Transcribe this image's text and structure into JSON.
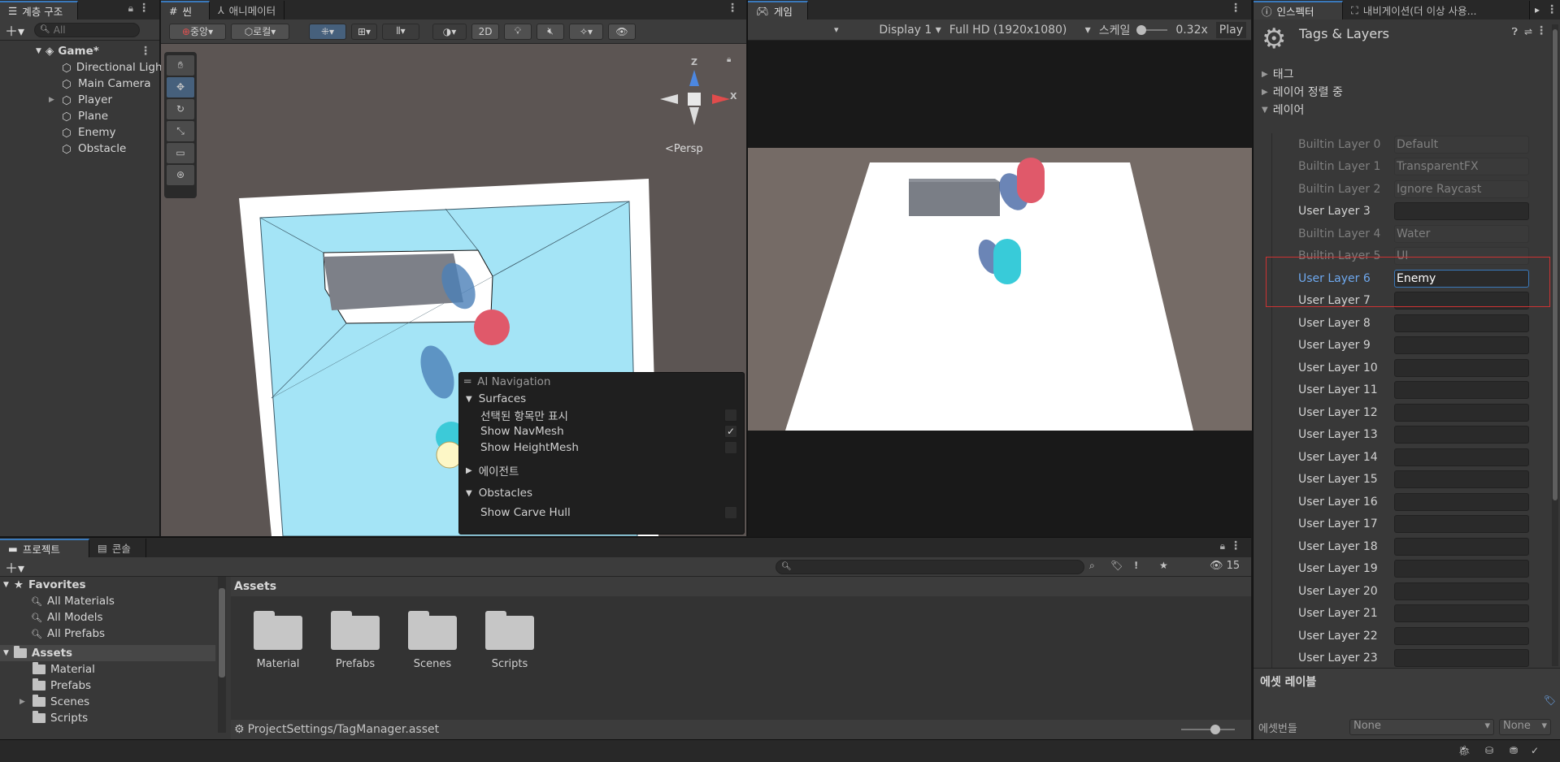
{
  "hierarchy": {
    "tab_label": "계층 구조",
    "search_placeholder": "All",
    "scene_name": "Game*",
    "items": [
      {
        "label": "Directional Light"
      },
      {
        "label": "Main Camera"
      },
      {
        "label": "Player"
      },
      {
        "label": "Plane"
      },
      {
        "label": "Enemy"
      },
      {
        "label": "Obstacle"
      }
    ]
  },
  "scene": {
    "tab_label": "씬",
    "anim_tab_label": "애니메이터",
    "pivot_label": "중앙",
    "space_label": "로컬",
    "mode_2d": "2D",
    "persp_label": "Persp",
    "gizmo_axes": {
      "y": "Z",
      "x": "X"
    }
  },
  "ai_navigation": {
    "title": "AI Navigation",
    "surfaces_label": "Surfaces",
    "options": [
      {
        "label": "선택된 항목만 표시",
        "checked": false
      },
      {
        "label": "Show NavMesh",
        "checked": true
      },
      {
        "label": "Show HeightMesh",
        "checked": false
      }
    ],
    "agents_label": "에이전트",
    "obstacles_label": "Obstacles",
    "carve_hull_label": "Show Carve Hull",
    "carve_hull_checked": false
  },
  "game": {
    "tab_label": "게임",
    "display": "Display 1",
    "resolution": "Full HD (1920x1080)",
    "scale_label": "스케일",
    "scale_value": "0.32x",
    "play_label": "Play"
  },
  "inspector": {
    "tab_label": "인스펙터",
    "nav_tab_label": "내비게이션(더 이상 사용...",
    "title": "Tags & Layers",
    "sections": {
      "tags": "태그",
      "sorting": "레이어 정렬 중",
      "layers": "레이어"
    },
    "layers": [
      {
        "name": "Builtin Layer 0",
        "value": "Default",
        "builtin": true
      },
      {
        "name": "Builtin Layer 1",
        "value": "TransparentFX",
        "builtin": true
      },
      {
        "name": "Builtin Layer 2",
        "value": "Ignore Raycast",
        "builtin": true
      },
      {
        "name": "User Layer 3",
        "value": "",
        "builtin": false
      },
      {
        "name": "Builtin Layer 4",
        "value": "Water",
        "builtin": true
      },
      {
        "name": "Builtin Layer 5",
        "value": "UI",
        "builtin": true
      },
      {
        "name": "User Layer 6",
        "value": "Enemy",
        "builtin": false,
        "selected": true
      },
      {
        "name": "User Layer 7",
        "value": "",
        "builtin": false
      },
      {
        "name": "User Layer 8",
        "value": "",
        "builtin": false
      },
      {
        "name": "User Layer 9",
        "value": "",
        "builtin": false
      },
      {
        "name": "User Layer 10",
        "value": "",
        "builtin": false
      },
      {
        "name": "User Layer 11",
        "value": "",
        "builtin": false
      },
      {
        "name": "User Layer 12",
        "value": "",
        "builtin": false
      },
      {
        "name": "User Layer 13",
        "value": "",
        "builtin": false
      },
      {
        "name": "User Layer 14",
        "value": "",
        "builtin": false
      },
      {
        "name": "User Layer 15",
        "value": "",
        "builtin": false
      },
      {
        "name": "User Layer 16",
        "value": "",
        "builtin": false
      },
      {
        "name": "User Layer 17",
        "value": "",
        "builtin": false
      },
      {
        "name": "User Layer 18",
        "value": "",
        "builtin": false
      },
      {
        "name": "User Layer 19",
        "value": "",
        "builtin": false
      },
      {
        "name": "User Layer 20",
        "value": "",
        "builtin": false
      },
      {
        "name": "User Layer 21",
        "value": "",
        "builtin": false
      },
      {
        "name": "User Layer 22",
        "value": "",
        "builtin": false
      },
      {
        "name": "User Layer 23",
        "value": "",
        "builtin": false
      }
    ],
    "asset_labels_title": "에셋 레이블",
    "asset_bundle_label": "에셋번들",
    "asset_bundle_value": "None",
    "asset_bundle_variant": "None"
  },
  "project": {
    "tab_label": "프로젝트",
    "console_tab_label": "콘솔",
    "favorites_label": "Favorites",
    "favorites": [
      {
        "label": "All Materials"
      },
      {
        "label": "All Models"
      },
      {
        "label": "All Prefabs"
      }
    ],
    "assets_label": "Assets",
    "asset_folders": [
      {
        "label": "Material"
      },
      {
        "label": "Prefabs"
      },
      {
        "label": "Scenes"
      },
      {
        "label": "Scripts"
      }
    ],
    "breadcrumb": "Assets",
    "hidden_count": "15",
    "footer_path": "ProjectSettings/TagManager.asset"
  }
}
